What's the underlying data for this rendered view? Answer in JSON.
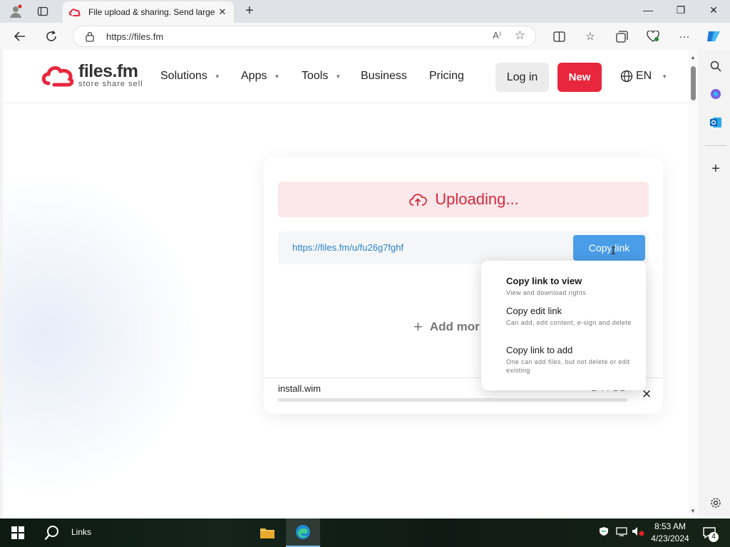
{
  "browser": {
    "tab_title": "File upload & sharing. Send large",
    "tab_close": "✕",
    "new_tab": "+",
    "url": "https://files.fm",
    "read_aloud": "A⁾"
  },
  "site": {
    "brand": "files.fm",
    "tagline": "store share sell",
    "nav": {
      "solutions": "Solutions",
      "apps": "Apps",
      "tools": "Tools",
      "business": "Business",
      "pricing": "Pricing"
    },
    "login": "Log in",
    "new": "New",
    "lang": "EN"
  },
  "upload": {
    "status": "Uploading...",
    "share_link": "https://files.fm/u/fu26g7fghf",
    "copy_button": "Copy link",
    "add_more": "Add mor",
    "file_name": "install.wim",
    "file_pct": "2 4 7 2 2",
    "progress": 0
  },
  "context_menu": {
    "items": [
      {
        "title": "Copy link to view",
        "desc": "View and download rights"
      },
      {
        "title": "Copy edit link",
        "desc": "Can add, edit content, e-sign and delete"
      },
      {
        "title": "Copy link to add",
        "desc": "One can add files, but not delete or edit existing"
      }
    ]
  },
  "taskbar": {
    "search_label": "Links",
    "time": "8:53 AM",
    "date": "4/23/2024",
    "notifications": "4"
  },
  "colors": {
    "brand_red": "#e8263d",
    "link_blue": "#2e83c9",
    "copy_blue": "#4a9de8",
    "banner_bg": "#fce8ea"
  }
}
